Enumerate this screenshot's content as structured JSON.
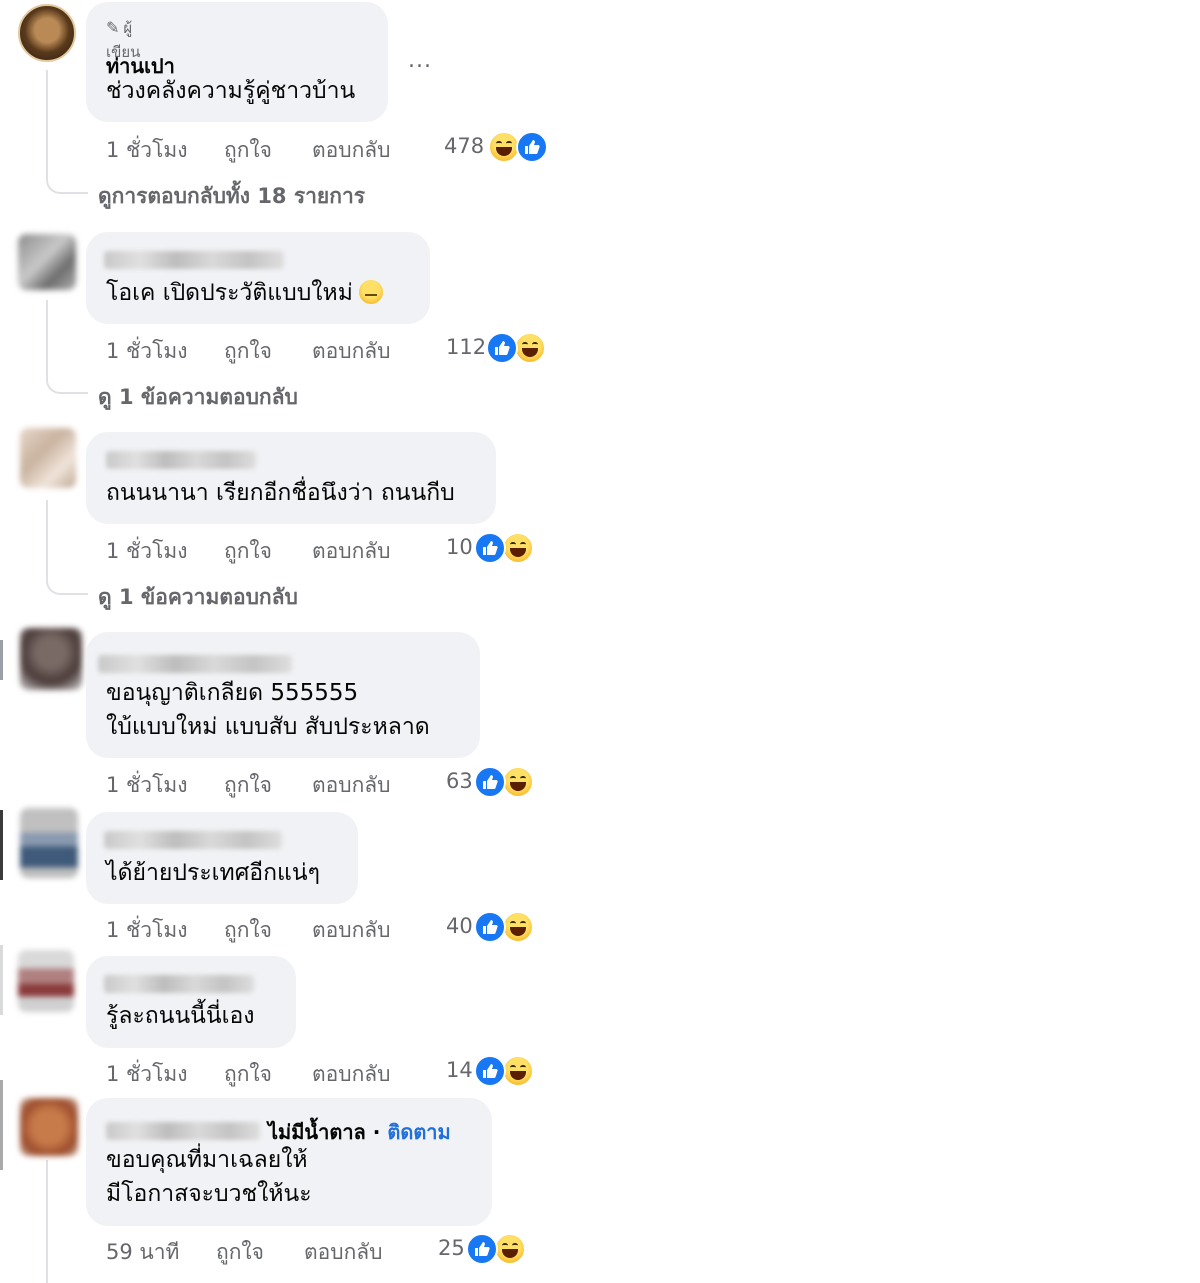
{
  "actions": {
    "like": "ถูกใจ",
    "reply": "ตอบกลับ"
  },
  "comments": [
    {
      "author_badge": "ผู้เขียน",
      "name": "ท่านเปา",
      "lines": [
        "ช่วงคลังความรู้คู่ชาวบ้าน"
      ],
      "time": "1 ชั่วโมง",
      "reactions": "478",
      "view_replies": "ดูการตอบกลับทั้ง 18 รายการ",
      "more": "..."
    },
    {
      "lines": [
        "โอเค เปิดประวัติแบบใหม่"
      ],
      "time": "1 ชั่วโมง",
      "reactions": "112",
      "view_replies": "ดู 1 ข้อความตอบกลับ"
    },
    {
      "lines": [
        "ถนนนานา เรียกอีกชื่อนึงว่า ถนนกีบ"
      ],
      "time": "1 ชั่วโมง",
      "reactions": "10",
      "view_replies": "ดู 1 ข้อความตอบกลับ"
    },
    {
      "lines": [
        "ขอนุญาติเกลียด 555555",
        "ใบ้แบบใหม่ แบบสับ สับประหลาด"
      ],
      "time": "1 ชั่วโมง",
      "reactions": "63"
    },
    {
      "lines": [
        "ได้ย้ายประเทศอีกแน่ๆ"
      ],
      "time": "1 ชั่วโมง",
      "reactions": "40"
    },
    {
      "lines": [
        "รู้ละถนนนี้นี่เอง"
      ],
      "time": "1 ชั่วโมง",
      "reactions": "14"
    },
    {
      "name_suffix": "ไม่มีน้ำตาล",
      "follow": "ติดตาม",
      "lines": [
        "ขอบคุณที่มาเฉลยให้",
        "มีโอกาสจะบวชให้นะ"
      ],
      "time": "59 นาที",
      "reactions": "25"
    }
  ],
  "icons": {
    "reaction_like": "like-reaction-icon",
    "reaction_haha": "haha-reaction-icon",
    "author": "pen-icon"
  },
  "colors": {
    "bubble": "#f0f2f5",
    "meta_text": "#65676b",
    "like_blue": "#1877f2",
    "follow_blue": "#216fdb"
  }
}
